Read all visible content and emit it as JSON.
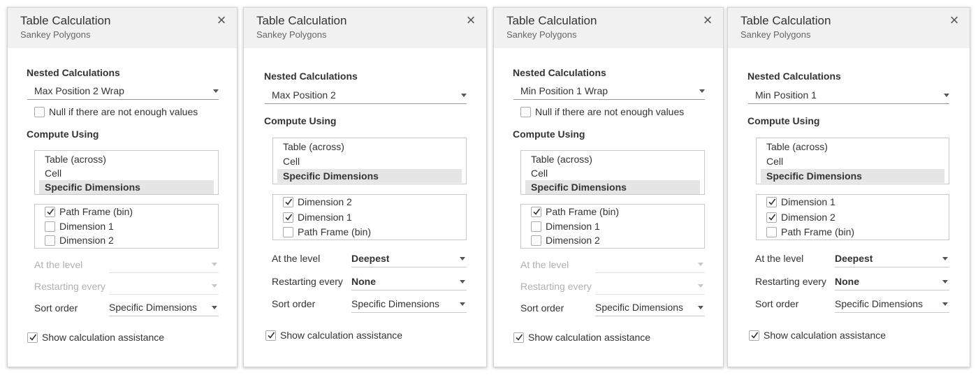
{
  "panels": [
    {
      "title": "Table Calculation",
      "subtitle": "Sankey Polygons",
      "close_glyph": "×",
      "nested_label": "Nested Calculations",
      "nested_value": "Max Position 2 Wrap",
      "null_label": "Null if there are not enough values",
      "null_checked": false,
      "compute_label": "Compute Using",
      "compute_options": [
        "Table (across)",
        "Cell",
        "Specific Dimensions"
      ],
      "compute_selected": "Specific Dimensions",
      "dimensions": [
        {
          "label": "Path Frame (bin)",
          "checked": true
        },
        {
          "label": "Dimension 1",
          "checked": false
        },
        {
          "label": "Dimension 2",
          "checked": false
        }
      ],
      "level_label": "At the level",
      "level_value": "",
      "restart_label": "Restarting every",
      "restart_value": "",
      "sort_label": "Sort order",
      "sort_value": "Specific Dimensions",
      "assist_label": "Show calculation assistance",
      "assist_checked": true
    },
    {
      "title": "Table Calculation",
      "subtitle": "Sankey Polygons",
      "close_glyph": "×",
      "nested_label": "Nested Calculations",
      "nested_value": "Max Position 2",
      "compute_label": "Compute Using",
      "compute_options": [
        "Table (across)",
        "Cell",
        "Specific Dimensions"
      ],
      "compute_selected": "Specific Dimensions",
      "dimensions": [
        {
          "label": "Dimension 2",
          "checked": true
        },
        {
          "label": "Dimension 1",
          "checked": true
        },
        {
          "label": "Path Frame (bin)",
          "checked": false
        }
      ],
      "level_label": "At the level",
      "level_value": "Deepest",
      "restart_label": "Restarting every",
      "restart_value": "None",
      "sort_label": "Sort order",
      "sort_value": "Specific Dimensions",
      "assist_label": "Show calculation assistance",
      "assist_checked": true
    },
    {
      "title": "Table Calculation",
      "subtitle": "Sankey Polygons",
      "close_glyph": "×",
      "nested_label": "Nested Calculations",
      "nested_value": "Min Position 1 Wrap",
      "null_label": "Null if there are not enough values",
      "null_checked": false,
      "compute_label": "Compute Using",
      "compute_options": [
        "Table (across)",
        "Cell",
        "Specific Dimensions"
      ],
      "compute_selected": "Specific Dimensions",
      "dimensions": [
        {
          "label": "Path Frame (bin)",
          "checked": true
        },
        {
          "label": "Dimension 1",
          "checked": false
        },
        {
          "label": "Dimension 2",
          "checked": false
        }
      ],
      "level_label": "At the level",
      "level_value": "",
      "restart_label": "Restarting every",
      "restart_value": "",
      "sort_label": "Sort order",
      "sort_value": "Specific Dimensions",
      "assist_label": "Show calculation assistance",
      "assist_checked": true
    },
    {
      "title": "Table Calculation",
      "subtitle": "Sankey Polygons",
      "close_glyph": "×",
      "nested_label": "Nested Calculations",
      "nested_value": "Min Position 1",
      "compute_label": "Compute Using",
      "compute_options": [
        "Table (across)",
        "Cell",
        "Specific Dimensions"
      ],
      "compute_selected": "Specific Dimensions",
      "dimensions": [
        {
          "label": "Dimension 1",
          "checked": true
        },
        {
          "label": "Dimension 2",
          "checked": true
        },
        {
          "label": "Path Frame (bin)",
          "checked": false
        }
      ],
      "level_label": "At the level",
      "level_value": "Deepest",
      "restart_label": "Restarting every",
      "restart_value": "None",
      "sort_label": "Sort order",
      "sort_value": "Specific Dimensions",
      "assist_label": "Show calculation assistance",
      "assist_checked": true
    }
  ]
}
